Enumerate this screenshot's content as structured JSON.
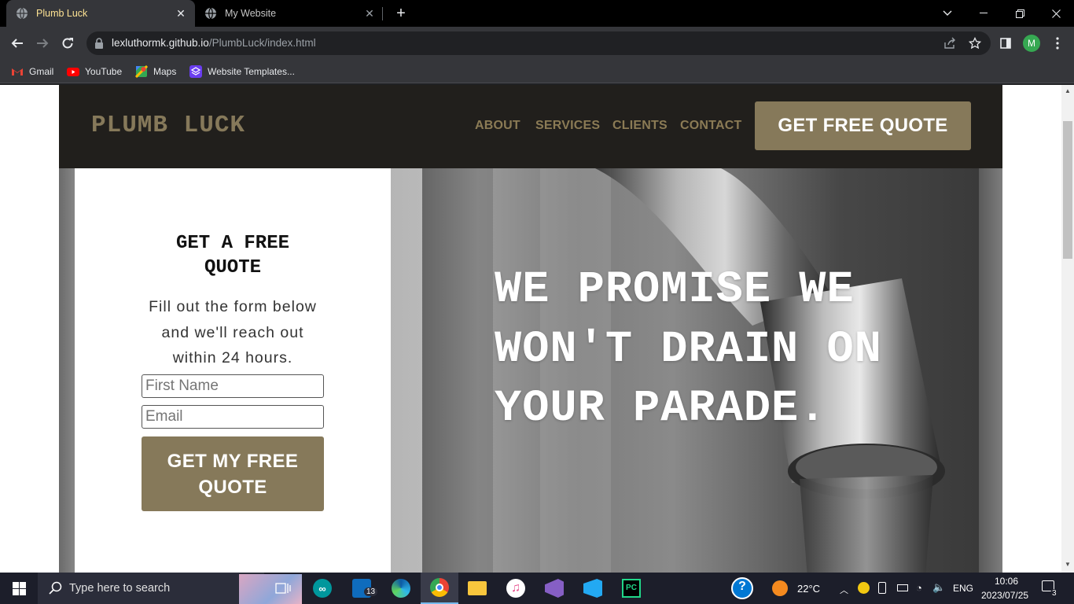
{
  "browser": {
    "tabs": [
      {
        "title": "Plumb Luck",
        "active": true
      },
      {
        "title": "My Website",
        "active": false
      }
    ],
    "url_host": "lexluthormk.github.io",
    "url_path": "/PlumbLuck/index.html",
    "profile_initial": "M",
    "bookmarks": [
      {
        "label": "Gmail",
        "icon": "gmail-icon"
      },
      {
        "label": "YouTube",
        "icon": "youtube-icon"
      },
      {
        "label": "Maps",
        "icon": "maps-icon"
      },
      {
        "label": "Website Templates...",
        "icon": "templates-icon"
      }
    ]
  },
  "site": {
    "logo": "PLUMB LUCK",
    "nav": [
      "ABOUT",
      "SERVICES",
      "CLIENTS",
      "CONTACT"
    ],
    "cta": "GET FREE QUOTE",
    "form": {
      "title": "GET A FREE QUOTE",
      "description": "Fill out the form below and we'll reach out within 24 hours.",
      "first_name_placeholder": "First Name",
      "email_placeholder": "Email",
      "submit": "GET MY FREE QUOTE"
    },
    "headline": "WE PROMISE WE WON'T DRAIN ON YOUR PARADE."
  },
  "taskbar": {
    "search_placeholder": "Type here to search",
    "mail_badge": "13",
    "weather": "22°C",
    "language": "ENG",
    "time": "10:06",
    "date": "2023/07/25",
    "notification_count": "3"
  }
}
